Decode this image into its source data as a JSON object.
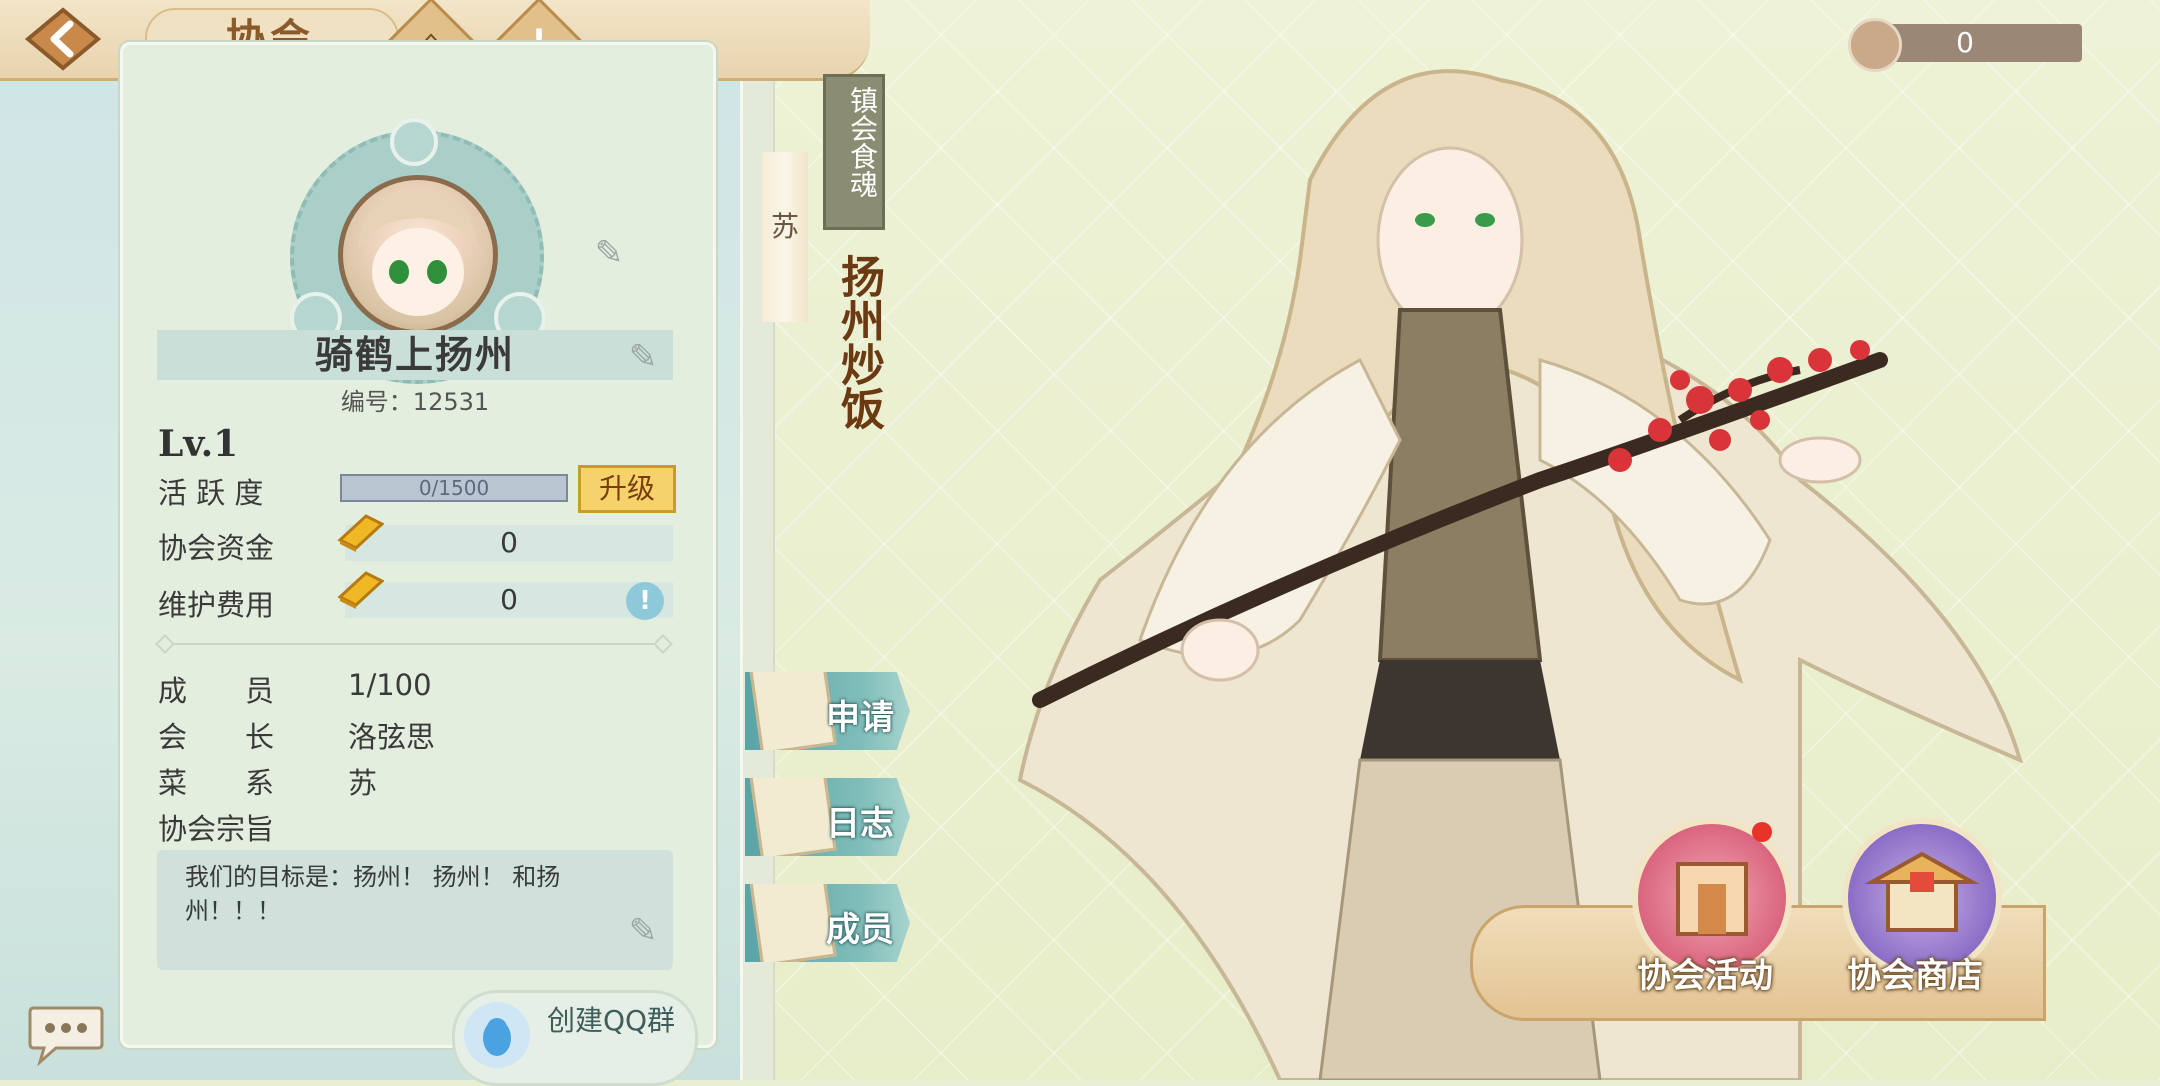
{
  "header": {
    "title": "协会"
  },
  "profile": {
    "name": "骑鹤上扬州",
    "id_text": "编号：12531",
    "level": "Lv.1",
    "activity_label": "活 跃 度",
    "activity_progress": "0/1500",
    "activity_fraction": 0,
    "upgrade_label": "升级",
    "funds_label": "协会资金",
    "funds_value": "0",
    "upkeep_label": "维护费用",
    "upkeep_value": "0"
  },
  "info": {
    "members_label": "成　　员",
    "members_value": "1/100",
    "leader_label": "会　　长",
    "leader_value": "洛弦思",
    "cuisine_label": "菜　　系",
    "cuisine_value": "苏",
    "motto_label": "协会宗旨",
    "motto_text": "我们的目标是：扬州！ 扬州！ 和扬州！！！"
  },
  "side_tabs": [
    {
      "label": "申请"
    },
    {
      "label": "日志"
    },
    {
      "label": "成员"
    }
  ],
  "scroll": {
    "cuisine_char": "苏",
    "tag": "镇会食魂",
    "dish_name": "扬州炒饭"
  },
  "currency": {
    "value": "0"
  },
  "dock": {
    "activity_label": "协会活动",
    "shop_label": "协会商店"
  },
  "qq": {
    "label": "创建QQ群"
  },
  "colors": {
    "accent_gold": "#f5d36a",
    "teal_tab": "#5aa3a6",
    "title_brown": "#8a5a2a",
    "dish_red_brown": "#6b3a12"
  }
}
